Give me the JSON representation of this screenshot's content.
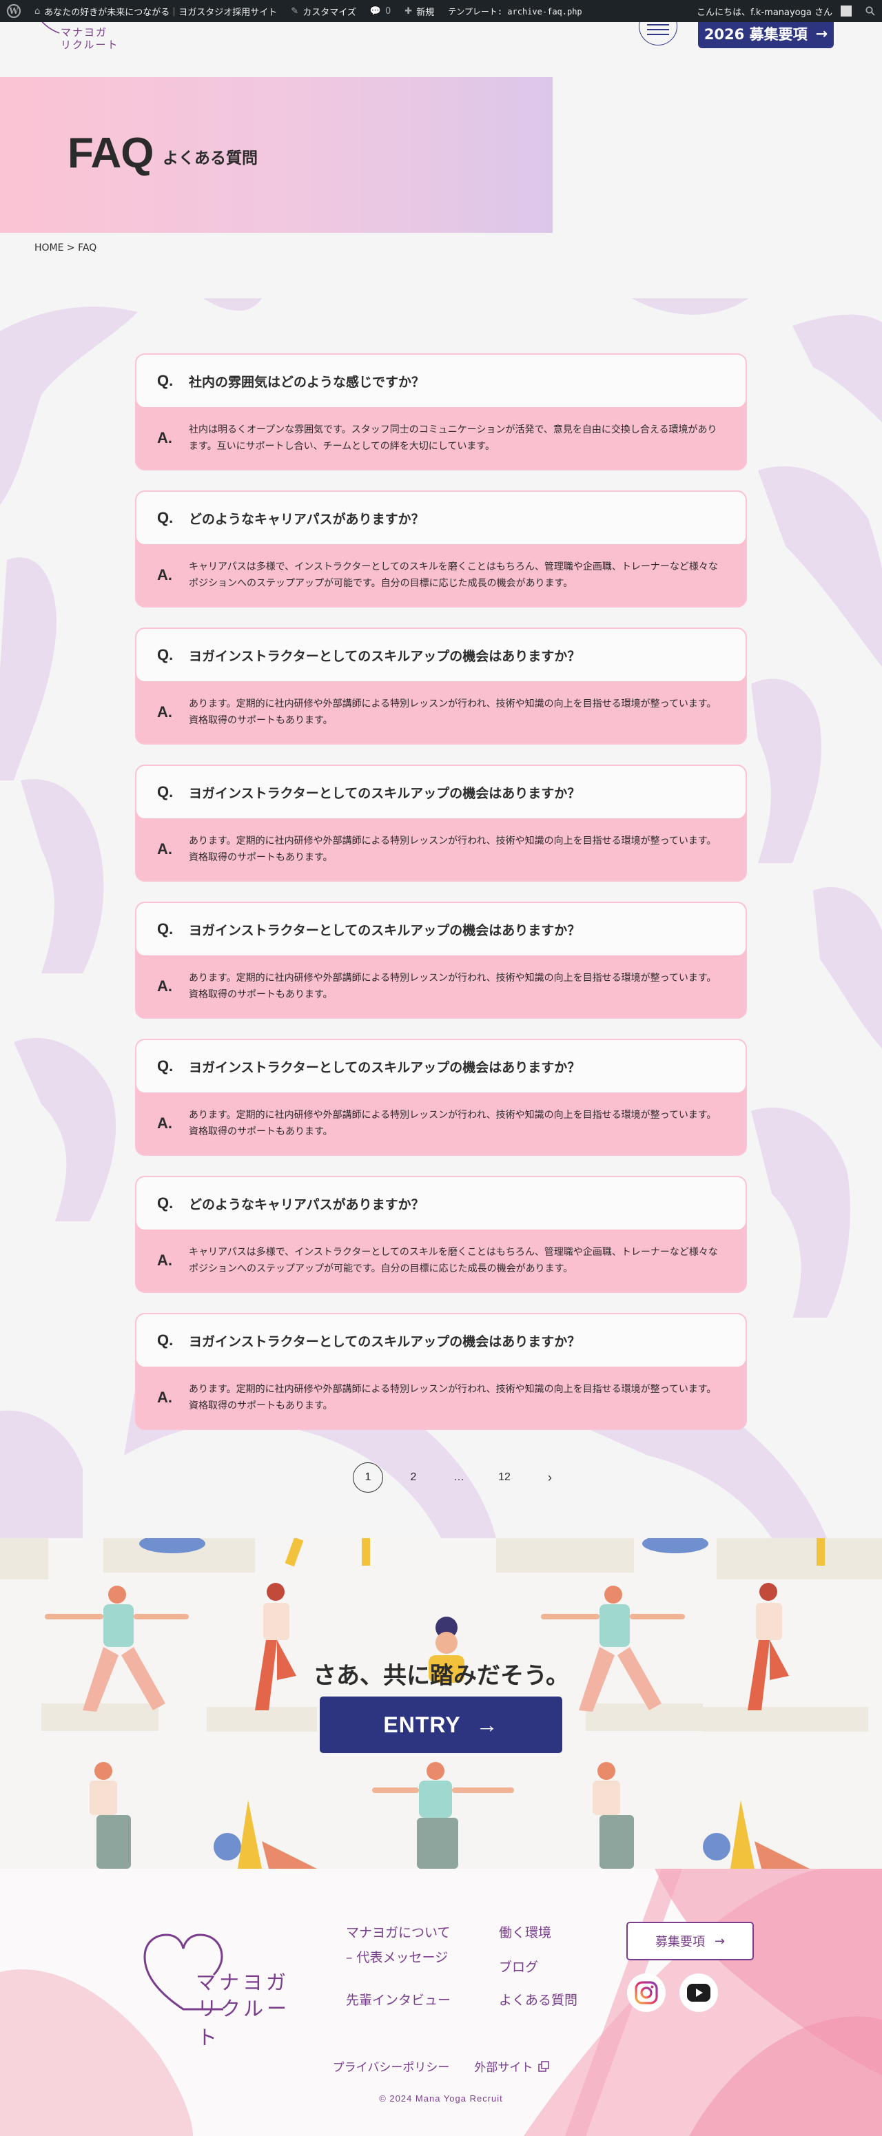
{
  "admin_bar": {
    "site_name": "あなたの好きが未来につながる｜ヨガスタジオ採用サイト",
    "customize": "カスタマイズ",
    "comments_count": "0",
    "new": "新規",
    "template": "テンプレート: archive-faq.php",
    "greeting": "こんにちは、f.k-manayoga さん"
  },
  "header": {
    "logo_line1": "マナヨガ",
    "logo_line2": "リクルート",
    "recruit_button": "2026 募集要項",
    "arrow": "→"
  },
  "hero": {
    "title": "FAQ",
    "subtitle": "よくある質問"
  },
  "breadcrumb": "HOME > FAQ",
  "faq": {
    "q_mark": "Q.",
    "a_mark": "A.",
    "items": [
      {
        "q": "社内の雰囲気はどのような感じですか？",
        "a": "社内は明るくオープンな雰囲気です。スタッフ同士のコミュニケーションが活発で、意見を自由に交換し合える環境があります。互いにサポートし合い、チームとしての絆を大切にしています。"
      },
      {
        "q": "どのようなキャリアパスがありますか？",
        "a": "キャリアパスは多様で、インストラクターとしてのスキルを磨くことはもちろん、管理職や企画職、トレーナーなど様々なポジションへのステップアップが可能です。自分の目標に応じた成長の機会があります。"
      },
      {
        "q": "ヨガインストラクターとしてのスキルアップの機会はありますか？",
        "a": "あります。定期的に社内研修や外部講師による特別レッスンが行われ、技術や知識の向上を目指せる環境が整っています。資格取得のサポートもあります。"
      },
      {
        "q": "ヨガインストラクターとしてのスキルアップの機会はありますか？",
        "a": "あります。定期的に社内研修や外部講師による特別レッスンが行われ、技術や知識の向上を目指せる環境が整っています。資格取得のサポートもあります。"
      },
      {
        "q": "ヨガインストラクターとしてのスキルアップの機会はありますか？",
        "a": "あります。定期的に社内研修や外部講師による特別レッスンが行われ、技術や知識の向上を目指せる環境が整っています。資格取得のサポートもあります。"
      },
      {
        "q": "ヨガインストラクターとしてのスキルアップの機会はありますか？",
        "a": "あります。定期的に社内研修や外部講師による特別レッスンが行われ、技術や知識の向上を目指せる環境が整っています。資格取得のサポートもあります。"
      },
      {
        "q": "どのようなキャリアパスがありますか？",
        "a": "キャリアパスは多様で、インストラクターとしてのスキルを磨くことはもちろん、管理職や企画職、トレーナーなど様々なポジションへのステップアップが可能です。自分の目標に応じた成長の機会があります。"
      },
      {
        "q": "ヨガインストラクターとしてのスキルアップの機会はありますか？",
        "a": "あります。定期的に社内研修や外部講師による特別レッスンが行われ、技術や知識の向上を目指せる環境が整っています。資格取得のサポートもあります。"
      }
    ]
  },
  "pagination": {
    "current": "1",
    "page2": "2",
    "dots": "…",
    "last": "12",
    "next": "›"
  },
  "entry": {
    "catch": "さあ、共に踏みだそう。",
    "button": "ENTRY",
    "arrow": "→"
  },
  "footer": {
    "logo_line1": "マナヨガ",
    "logo_line2": "リクルート",
    "links": {
      "about": "マナヨガについて",
      "message": "– 代表メッセージ",
      "interview": "先輩インタビュー",
      "environment": "働く環境",
      "blog": "ブログ",
      "faq": "よくある質問"
    },
    "recruit_button": "募集要項",
    "arrow": "→",
    "privacy": "プライバシーポリシー",
    "external": "外部サイト",
    "copyright": "© 2024 Mana Yoga Recruit"
  },
  "colors": {
    "navy": "#2e3580",
    "purple": "#7a3d8c",
    "pink": "#fbc0d0",
    "lavender": "#dcc7ea"
  }
}
